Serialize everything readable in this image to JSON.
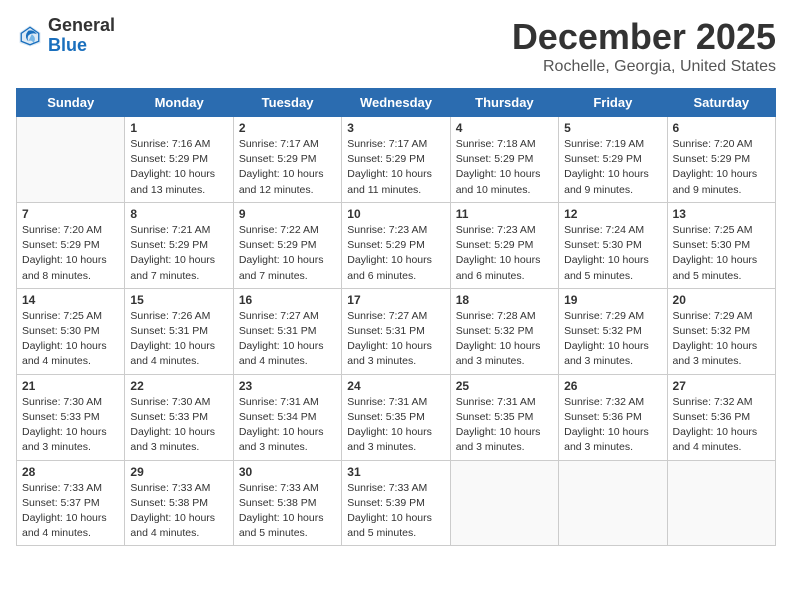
{
  "logo": {
    "general": "General",
    "blue": "Blue"
  },
  "title": "December 2025",
  "location": "Rochelle, Georgia, United States",
  "days_header": [
    "Sunday",
    "Monday",
    "Tuesday",
    "Wednesday",
    "Thursday",
    "Friday",
    "Saturday"
  ],
  "weeks": [
    [
      {
        "num": "",
        "info": ""
      },
      {
        "num": "1",
        "info": "Sunrise: 7:16 AM\nSunset: 5:29 PM\nDaylight: 10 hours\nand 13 minutes."
      },
      {
        "num": "2",
        "info": "Sunrise: 7:17 AM\nSunset: 5:29 PM\nDaylight: 10 hours\nand 12 minutes."
      },
      {
        "num": "3",
        "info": "Sunrise: 7:17 AM\nSunset: 5:29 PM\nDaylight: 10 hours\nand 11 minutes."
      },
      {
        "num": "4",
        "info": "Sunrise: 7:18 AM\nSunset: 5:29 PM\nDaylight: 10 hours\nand 10 minutes."
      },
      {
        "num": "5",
        "info": "Sunrise: 7:19 AM\nSunset: 5:29 PM\nDaylight: 10 hours\nand 9 minutes."
      },
      {
        "num": "6",
        "info": "Sunrise: 7:20 AM\nSunset: 5:29 PM\nDaylight: 10 hours\nand 9 minutes."
      }
    ],
    [
      {
        "num": "7",
        "info": "Sunrise: 7:20 AM\nSunset: 5:29 PM\nDaylight: 10 hours\nand 8 minutes."
      },
      {
        "num": "8",
        "info": "Sunrise: 7:21 AM\nSunset: 5:29 PM\nDaylight: 10 hours\nand 7 minutes."
      },
      {
        "num": "9",
        "info": "Sunrise: 7:22 AM\nSunset: 5:29 PM\nDaylight: 10 hours\nand 7 minutes."
      },
      {
        "num": "10",
        "info": "Sunrise: 7:23 AM\nSunset: 5:29 PM\nDaylight: 10 hours\nand 6 minutes."
      },
      {
        "num": "11",
        "info": "Sunrise: 7:23 AM\nSunset: 5:29 PM\nDaylight: 10 hours\nand 6 minutes."
      },
      {
        "num": "12",
        "info": "Sunrise: 7:24 AM\nSunset: 5:30 PM\nDaylight: 10 hours\nand 5 minutes."
      },
      {
        "num": "13",
        "info": "Sunrise: 7:25 AM\nSunset: 5:30 PM\nDaylight: 10 hours\nand 5 minutes."
      }
    ],
    [
      {
        "num": "14",
        "info": "Sunrise: 7:25 AM\nSunset: 5:30 PM\nDaylight: 10 hours\nand 4 minutes."
      },
      {
        "num": "15",
        "info": "Sunrise: 7:26 AM\nSunset: 5:31 PM\nDaylight: 10 hours\nand 4 minutes."
      },
      {
        "num": "16",
        "info": "Sunrise: 7:27 AM\nSunset: 5:31 PM\nDaylight: 10 hours\nand 4 minutes."
      },
      {
        "num": "17",
        "info": "Sunrise: 7:27 AM\nSunset: 5:31 PM\nDaylight: 10 hours\nand 3 minutes."
      },
      {
        "num": "18",
        "info": "Sunrise: 7:28 AM\nSunset: 5:32 PM\nDaylight: 10 hours\nand 3 minutes."
      },
      {
        "num": "19",
        "info": "Sunrise: 7:29 AM\nSunset: 5:32 PM\nDaylight: 10 hours\nand 3 minutes."
      },
      {
        "num": "20",
        "info": "Sunrise: 7:29 AM\nSunset: 5:32 PM\nDaylight: 10 hours\nand 3 minutes."
      }
    ],
    [
      {
        "num": "21",
        "info": "Sunrise: 7:30 AM\nSunset: 5:33 PM\nDaylight: 10 hours\nand 3 minutes."
      },
      {
        "num": "22",
        "info": "Sunrise: 7:30 AM\nSunset: 5:33 PM\nDaylight: 10 hours\nand 3 minutes."
      },
      {
        "num": "23",
        "info": "Sunrise: 7:31 AM\nSunset: 5:34 PM\nDaylight: 10 hours\nand 3 minutes."
      },
      {
        "num": "24",
        "info": "Sunrise: 7:31 AM\nSunset: 5:35 PM\nDaylight: 10 hours\nand 3 minutes."
      },
      {
        "num": "25",
        "info": "Sunrise: 7:31 AM\nSunset: 5:35 PM\nDaylight: 10 hours\nand 3 minutes."
      },
      {
        "num": "26",
        "info": "Sunrise: 7:32 AM\nSunset: 5:36 PM\nDaylight: 10 hours\nand 3 minutes."
      },
      {
        "num": "27",
        "info": "Sunrise: 7:32 AM\nSunset: 5:36 PM\nDaylight: 10 hours\nand 4 minutes."
      }
    ],
    [
      {
        "num": "28",
        "info": "Sunrise: 7:33 AM\nSunset: 5:37 PM\nDaylight: 10 hours\nand 4 minutes."
      },
      {
        "num": "29",
        "info": "Sunrise: 7:33 AM\nSunset: 5:38 PM\nDaylight: 10 hours\nand 4 minutes."
      },
      {
        "num": "30",
        "info": "Sunrise: 7:33 AM\nSunset: 5:38 PM\nDaylight: 10 hours\nand 5 minutes."
      },
      {
        "num": "31",
        "info": "Sunrise: 7:33 AM\nSunset: 5:39 PM\nDaylight: 10 hours\nand 5 minutes."
      },
      {
        "num": "",
        "info": ""
      },
      {
        "num": "",
        "info": ""
      },
      {
        "num": "",
        "info": ""
      }
    ]
  ]
}
